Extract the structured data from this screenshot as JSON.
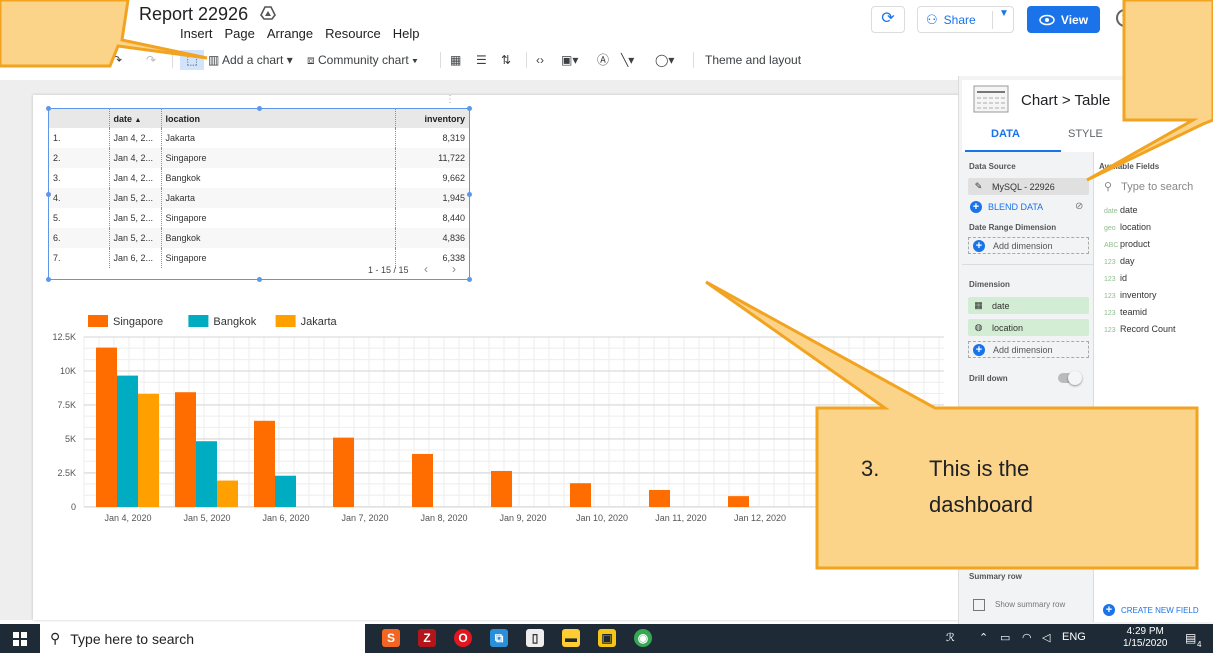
{
  "header": {
    "report_title": "Report 22926",
    "menu": [
      "Insert",
      "Page",
      "Arrange",
      "Resource",
      "Help"
    ],
    "share_label": "Share",
    "view_label": "View"
  },
  "toolbar": {
    "add_chart": "Add a chart",
    "community_chart": "Community chart",
    "theme_layout": "Theme and layout"
  },
  "table": {
    "columns": [
      "",
      "date",
      "location",
      "inventory"
    ],
    "rows": [
      [
        "1.",
        "Jan 4, 2...",
        "Jakarta",
        "8,319"
      ],
      [
        "2.",
        "Jan 4, 2...",
        "Singapore",
        "11,722"
      ],
      [
        "3.",
        "Jan 4, 2...",
        "Bangkok",
        "9,662"
      ],
      [
        "4.",
        "Jan 5, 2...",
        "Jakarta",
        "1,945"
      ],
      [
        "5.",
        "Jan 5, 2...",
        "Singapore",
        "8,440"
      ],
      [
        "6.",
        "Jan 5, 2...",
        "Bangkok",
        "4,836"
      ],
      [
        "7.",
        "Jan 6, 2...",
        "Singapore",
        "6,338"
      ]
    ],
    "pagination": "1 - 15 / 15",
    "sort_indicator": "▲"
  },
  "chart_data": {
    "type": "bar",
    "categories": [
      "Jan 4, 2020",
      "Jan 5, 2020",
      "Jan 6, 2020",
      "Jan 7, 2020",
      "Jan 8, 2020",
      "Jan 9, 2020",
      "Jan 10, 2020",
      "Jan 11, 2020",
      "Jan 12, 2020"
    ],
    "series": [
      {
        "name": "Singapore",
        "color": "#ff6d00",
        "values": [
          11722,
          8440,
          6338,
          5100,
          3900,
          2650,
          1750,
          1250,
          800
        ]
      },
      {
        "name": "Bangkok",
        "color": "#00acc1",
        "values": [
          9662,
          4836,
          2300,
          0,
          0,
          0,
          0,
          0,
          0
        ]
      },
      {
        "name": "Jakarta",
        "color": "#ffa000",
        "values": [
          8319,
          1945,
          0,
          0,
          0,
          0,
          0,
          0,
          0
        ]
      }
    ],
    "yticks": [
      "0",
      "2.5K",
      "5K",
      "7.5K",
      "10K",
      "12.5K"
    ],
    "ylim": [
      0,
      12500
    ],
    "legend": "top-left",
    "grid": true
  },
  "panel": {
    "breadcrumb_chart": "Chart",
    "breadcrumb_sep": ">",
    "breadcrumb_table": "Table",
    "tab_data": "DATA",
    "tab_style": "STYLE",
    "data_source_label": "Data Source",
    "data_source": "MySQL - 22926",
    "blend_data": "BLEND DATA",
    "date_range_label": "Date Range Dimension",
    "add_dimension": "Add dimension",
    "dimension_label": "Dimension",
    "dimensions": [
      "date",
      "location"
    ],
    "drill_down": "Drill down",
    "summary_row": "Summary row",
    "show_summary": "Show summary row",
    "available_fields_label": "Available Fields",
    "search_placeholder": "Type to search",
    "fields": [
      {
        "type": "date",
        "name": "date"
      },
      {
        "type": "geo",
        "name": "location"
      },
      {
        "type": "ABC",
        "name": "product"
      },
      {
        "type": "123",
        "name": "day"
      },
      {
        "type": "123",
        "name": "id"
      },
      {
        "type": "123",
        "name": "inventory"
      },
      {
        "type": "123",
        "name": "teamid"
      },
      {
        "type": "123",
        "name": "Record Count"
      }
    ],
    "create_field": "CREATE NEW FIELD"
  },
  "callout": {
    "number": "3.",
    "line1": "This is the",
    "line2": "dashboard",
    "fill": "#fbd48a",
    "stroke": "#f2a31f"
  },
  "taskbar": {
    "search_placeholder": "Type here to search",
    "lang": "ENG",
    "time": "4:29 PM",
    "date": "1/15/2020",
    "notif_count": "4"
  }
}
